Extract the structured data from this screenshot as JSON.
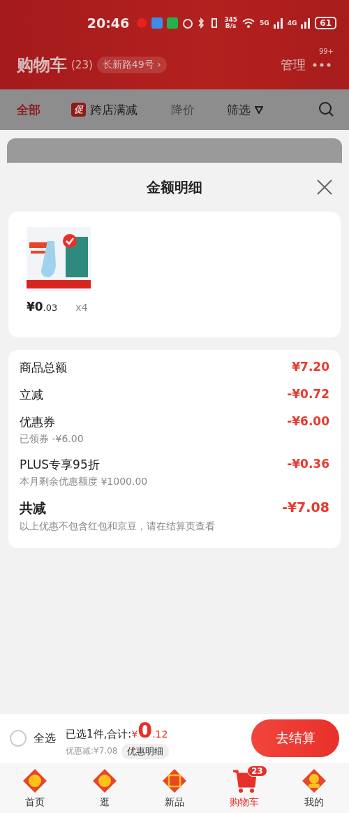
{
  "status_bar": {
    "time": "20:46",
    "net_speed": "345",
    "net_unit": "B/s",
    "net_5g": "5G",
    "net_4g": "4G",
    "battery": "61"
  },
  "header": {
    "title": "购物车",
    "count": "(23)",
    "address": "长新路49号",
    "address_caret": "›",
    "manage": "管理",
    "badge": "99+"
  },
  "filter_tabs": [
    {
      "label": "全部",
      "selected": true,
      "kind": "text"
    },
    {
      "label": "跨店满减",
      "selected": false,
      "kind": "promo",
      "tag": "促"
    },
    {
      "label": "降价",
      "selected": false,
      "kind": "muted"
    },
    {
      "label": "筛选",
      "selected": false,
      "kind": "filter"
    }
  ],
  "sheet": {
    "title": "金额明细",
    "product": {
      "price_main": "¥0",
      "price_cents": ".03",
      "quantity": "x4"
    },
    "lines": [
      {
        "label": "商品总额",
        "value": "¥7.20",
        "kind": "normal"
      },
      {
        "label": "立减",
        "value": "-¥0.72",
        "kind": "normal"
      },
      {
        "label": "优惠券",
        "value": "-¥6.00",
        "note": "已领券 -¥6.00",
        "kind": "normal"
      },
      {
        "label": "PLUS专享95折",
        "value": "-¥0.36",
        "note": "本月剩余优惠额度 ¥1000.00",
        "kind": "normal"
      },
      {
        "label": "共减",
        "value": "-¥7.08",
        "note": "以上优惠不包含红包和京豆，请在结算页查看",
        "kind": "total"
      }
    ]
  },
  "checkout": {
    "select_all": "全选",
    "select_all_checked": false,
    "summary": "已选1件,合计:",
    "currency": "¥",
    "total_main": "0",
    "total_cents": ".12",
    "discount": "优惠减:¥7.08",
    "detail_button": "优惠明细",
    "submit": "去结算"
  },
  "bottom_nav": [
    {
      "label": "首页",
      "selected": false
    },
    {
      "label": "逛",
      "selected": false
    },
    {
      "label": "新品",
      "selected": false
    },
    {
      "label": "购物车",
      "selected": true,
      "badge": "23"
    },
    {
      "label": "我的",
      "selected": false
    }
  ]
}
